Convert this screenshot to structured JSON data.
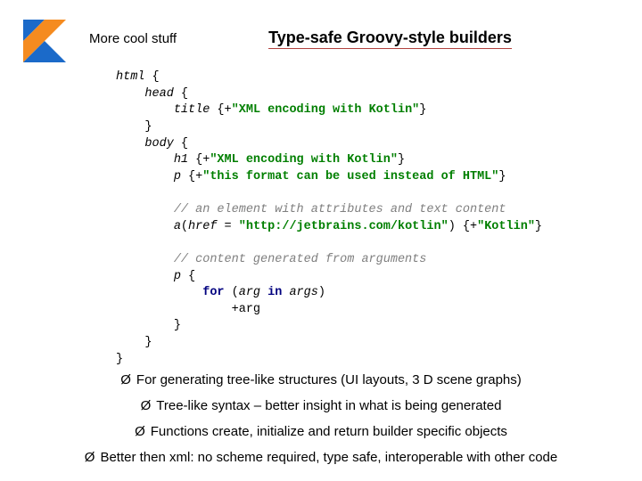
{
  "header": {
    "subtitle": "More cool stuff",
    "title": "Type-safe Groovy-style builders"
  },
  "code": {
    "l1_name": "html",
    "l2_name": "head",
    "l3_name": "title",
    "l3_str": "\"XML encoding with Kotlin\"",
    "l5_name": "body",
    "l6_name": "h1",
    "l6_str": "\"XML encoding with Kotlin\"",
    "l7_name": "p",
    "l7_str": "\"this format can be used instead of HTML\"",
    "c1": "// an element with attributes and text content",
    "a_name": "a",
    "a_arg": "href = ",
    "a_url": "\"http://jetbrains.com/kotlin\"",
    "a_str": "\"Kotlin\"",
    "c2": "// content generated from arguments",
    "p2_name": "p",
    "for_kw": "for",
    "for_open": " (",
    "for_var": "arg",
    "in_kw": " in ",
    "for_coll": "args",
    "for_close": ")",
    "for_body": "+arg"
  },
  "bullets": {
    "b1": "For generating tree-like structures (UI layouts, 3 D scene graphs)",
    "b2": "Tree-like syntax – better insight in what is being generated",
    "b3": "Functions create, initialize and return builder specific objects",
    "b4": "Better then xml: no scheme required, type safe, interoperable with other code"
  },
  "marker": "Ø"
}
